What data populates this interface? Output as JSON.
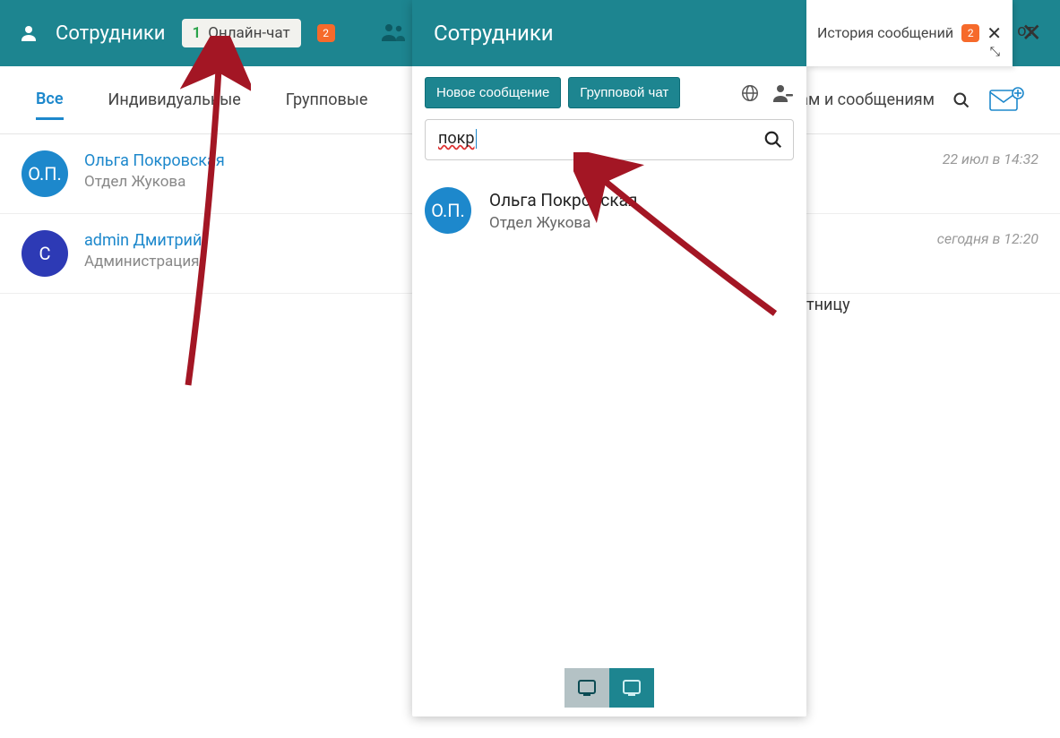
{
  "header": {
    "title": "Сотрудники",
    "online_chat_label": "Онлайн-чат",
    "online_count": "1",
    "badge": "2"
  },
  "tabs": {
    "all": "Все",
    "individual": "Индивидуальные",
    "group": "Групповые",
    "search_hint": "ам и сообщениям"
  },
  "bg_list": [
    {
      "initials": "О.П.",
      "name": "Ольга Покровская",
      "dept": "Отдел Жукова",
      "time": "22 июл в 14:32"
    },
    {
      "initials": "С",
      "name": "admin Дмитрий",
      "dept": "Администрация",
      "time": "сегодня в 12:20"
    }
  ],
  "bg_fragment": "тницу",
  "popup": {
    "title": "Сотрудники",
    "history_label": "История сообщений",
    "history_badge": "2",
    "btn_new": "Новое сообщение",
    "btn_group": "Групповой чат",
    "search_value": "покр",
    "result": {
      "initials": "О.П.",
      "name": "Ольга Покровская",
      "dept": "Отдел Жукова"
    },
    "side_fragment": "от"
  }
}
